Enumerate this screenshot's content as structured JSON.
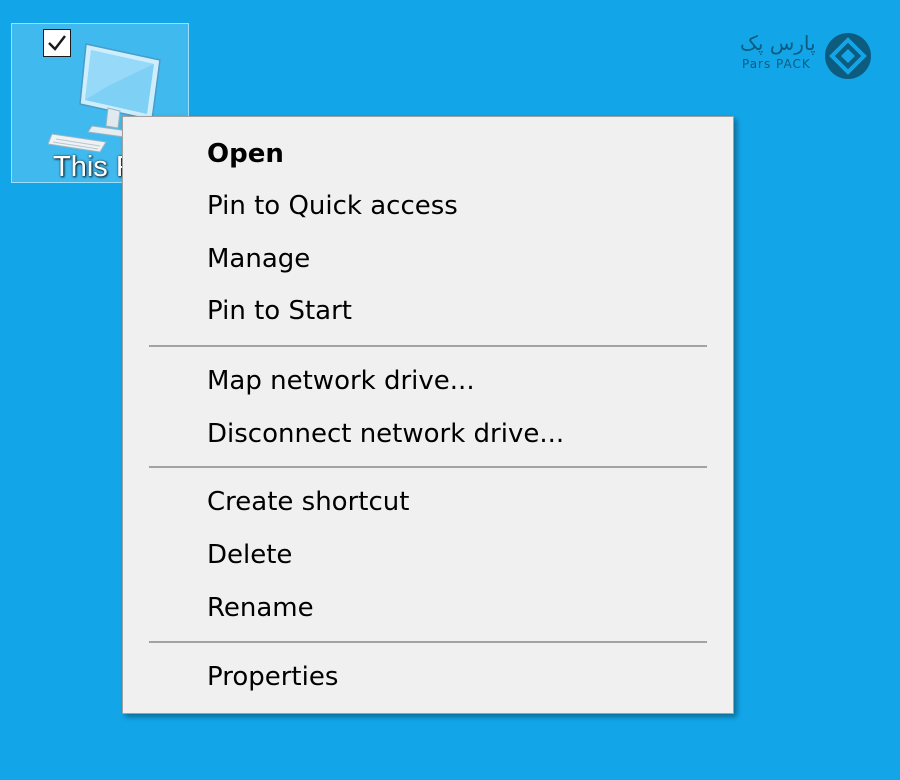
{
  "desktop": {
    "icon": {
      "label": "This PC",
      "selected": true,
      "icon_name": "computer-icon"
    },
    "logo": {
      "persian_text": "پارس پک",
      "latin_text": "Pars PACK",
      "icon_name": "parspack-logo-icon"
    }
  },
  "context_menu": {
    "open": "Open",
    "pin_quick_access": "Pin to Quick access",
    "manage": "Manage",
    "pin_start": "Pin to Start",
    "map_drive": "Map network drive...",
    "disconnect_drive": "Disconnect network drive...",
    "create_shortcut": "Create shortcut",
    "delete": "Delete",
    "rename": "Rename",
    "properties": "Properties"
  },
  "colors": {
    "desktop_background": "#12a6e8",
    "menu_background": "#f0f0f0",
    "logo": "#0d5c80"
  }
}
